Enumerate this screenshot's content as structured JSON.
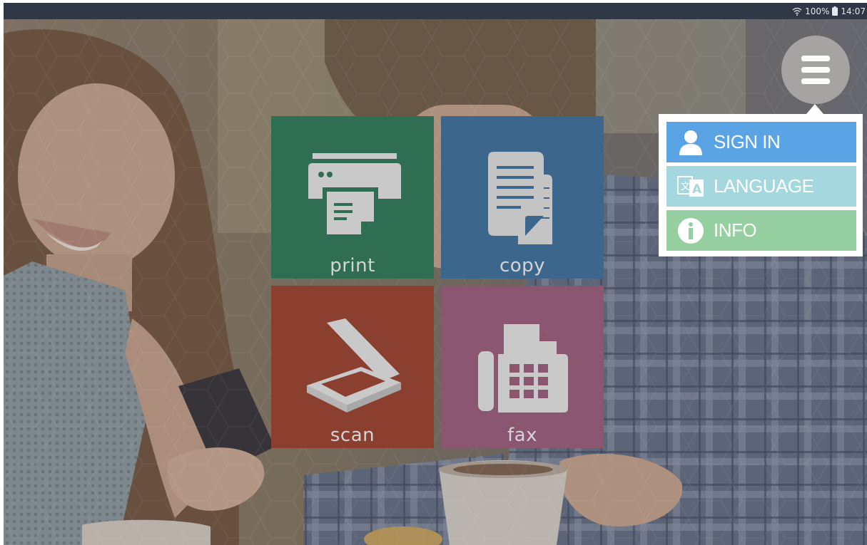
{
  "status_bar": {
    "battery": "100%",
    "time": "14:07",
    "icons": [
      "wifi-icon",
      "battery-icon"
    ]
  },
  "tiles": [
    {
      "id": "print",
      "label": "print",
      "icon": "printer-icon",
      "color": "#2f6e53"
    },
    {
      "id": "copy",
      "label": "copy",
      "icon": "copy-document-icon",
      "color": "#3c668c"
    },
    {
      "id": "scan",
      "label": "scan",
      "icon": "scanner-icon",
      "color": "#8a3f2f"
    },
    {
      "id": "fax",
      "label": "fax",
      "icon": "fax-icon",
      "color": "#8b5670"
    }
  ],
  "menu": {
    "button_icon": "hamburger-menu-icon",
    "items": [
      {
        "label": "SIGN IN",
        "icon": "user-icon",
        "color": "#5aa3e4"
      },
      {
        "label": "LANGUAGE",
        "icon": "translate-icon",
        "color": "#a5d8de"
      },
      {
        "label": "INFO",
        "icon": "info-icon",
        "color": "#96cfa0"
      }
    ]
  }
}
